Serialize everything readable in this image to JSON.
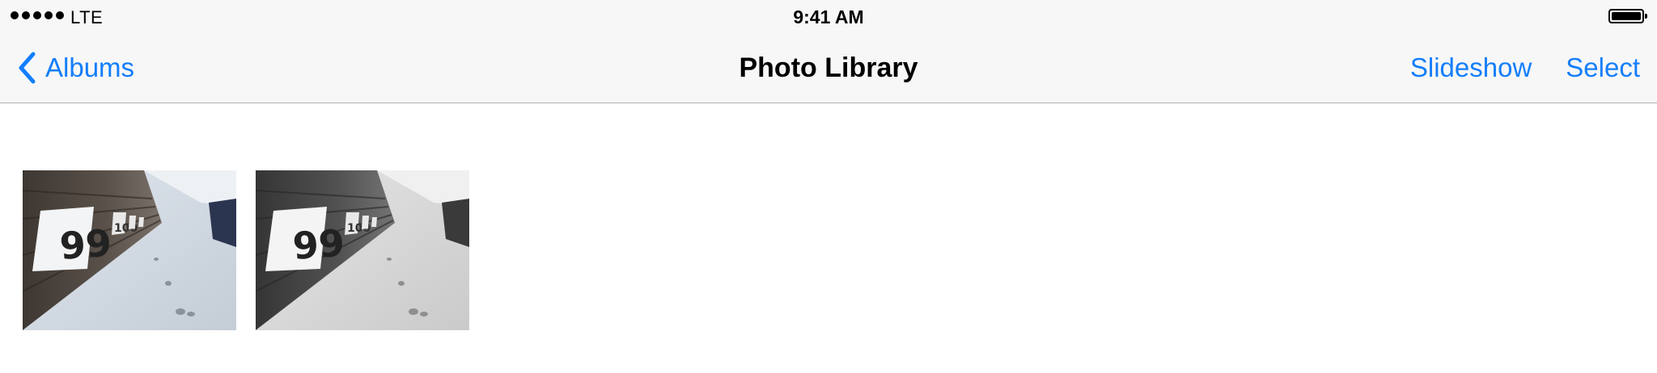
{
  "status_bar": {
    "carrier": "LTE",
    "time": "9:41 AM",
    "signal_icon": "signal-dots-icon",
    "battery_icon": "battery-full-icon"
  },
  "nav": {
    "back_label": "Albums",
    "back_icon": "chevron-left-icon",
    "title": "Photo Library",
    "slideshow_label": "Slideshow",
    "select_label": "Select"
  },
  "photos": [
    {
      "number_label": "99",
      "second_label": "100",
      "tint": "color"
    },
    {
      "number_label": "99",
      "second_label": "100",
      "tint": "grayscale"
    }
  ],
  "colors": {
    "accent": "#147efb",
    "bar_background": "#f7f7f7",
    "separator": "#b2b2b2"
  }
}
